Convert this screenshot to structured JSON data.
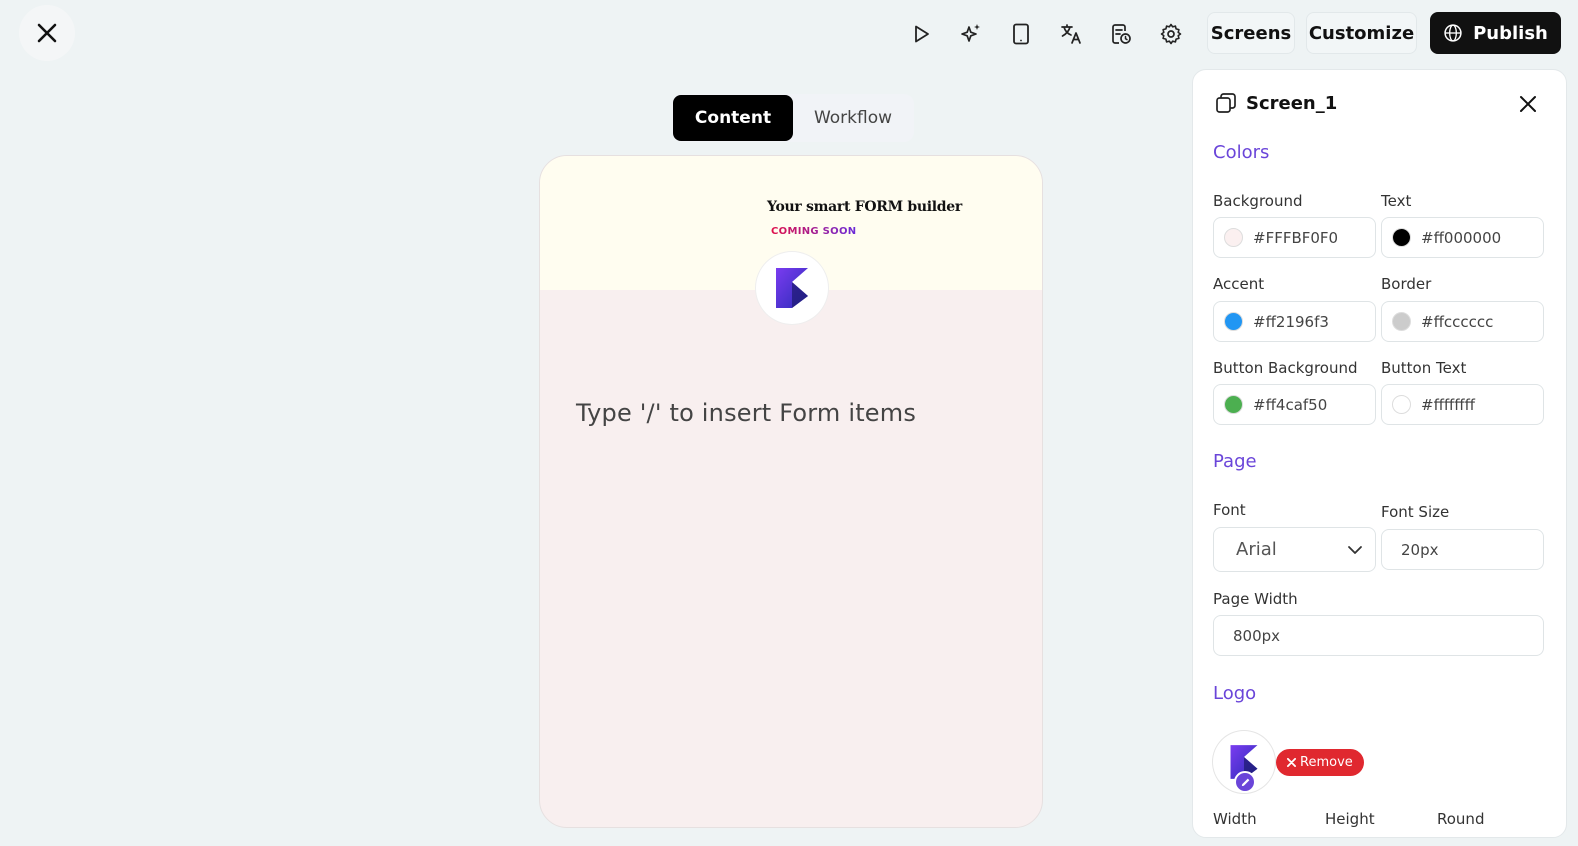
{
  "toolbar": {
    "screens_label": "Screens",
    "customize_label": "Customize",
    "publish_label": "Publish"
  },
  "tabs": [
    {
      "label": "Content",
      "active": true
    },
    {
      "label": "Workflow",
      "active": false
    }
  ],
  "preview": {
    "header_title": "Your smart FORM builder",
    "header_subtitle": "COMING SOON",
    "placeholder": "Type '/' to insert Form items"
  },
  "panel": {
    "title": "Screen_1",
    "colors": {
      "section_title": "Colors",
      "background": {
        "label": "Background",
        "value": "#FFFBF0F0",
        "swatch": "#FBF0F0"
      },
      "text": {
        "label": "Text",
        "value": "#ff000000",
        "swatch": "#000000"
      },
      "accent": {
        "label": "Accent",
        "value": "#ff2196f3",
        "swatch": "#2196f3"
      },
      "border": {
        "label": "Border",
        "value": "#ffcccccc",
        "swatch": "#cccccc"
      },
      "button_background": {
        "label": "Button Background",
        "value": "#ff4caf50",
        "swatch": "#4caf50"
      },
      "button_text": {
        "label": "Button Text",
        "value": "#ffffffff",
        "swatch": "#ffffff"
      }
    },
    "page": {
      "section_title": "Page",
      "font_label": "Font",
      "font_value": "Arial",
      "font_size_label": "Font Size",
      "font_size_value": "20px",
      "page_width_label": "Page Width",
      "page_width_value": "800px"
    },
    "logo": {
      "section_title": "Logo",
      "remove_label": "Remove",
      "cut_labels": [
        "Width",
        "Height",
        "Round"
      ]
    }
  },
  "icons": [
    "close-icon",
    "play-icon",
    "sparkles-icon",
    "tablet-icon",
    "translate-icon",
    "history-icon",
    "settings-icon",
    "globe-icon",
    "screens-icon",
    "chevron-down-icon",
    "edit-icon"
  ]
}
